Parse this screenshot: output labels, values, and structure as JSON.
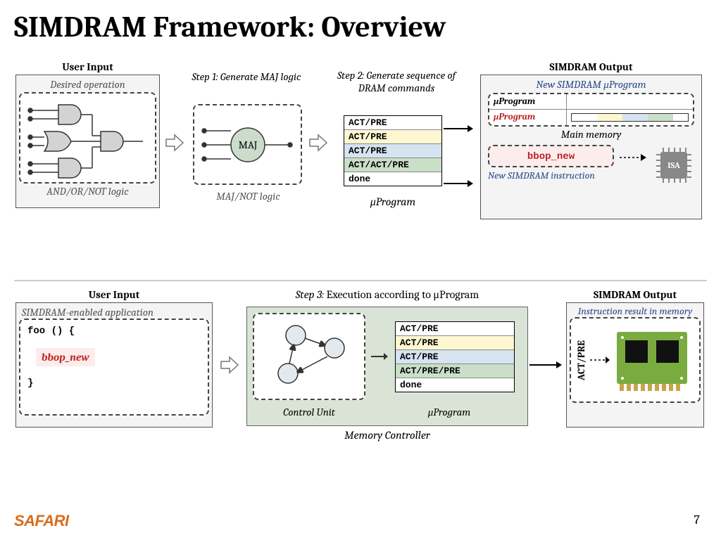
{
  "title": "SIMDRAM Framework: Overview",
  "top": {
    "userInputLabel": "User Input",
    "desiredOp": "Desired operation",
    "andOrNot": "AND/OR/NOT logic",
    "step1": "Step 1: Generate MAJ logic",
    "maj": "MAJ",
    "majNot": "MAJ/NOT logic",
    "step2": "Step 2: Generate sequence of DRAM commands",
    "cmds": [
      "ACT/PRE",
      "ACT/PRE",
      "ACT/PRE",
      "ACT/ACT/PRE",
      "done"
    ],
    "uprog": "μProgram",
    "outputLabel": "SIMDRAM Output",
    "newUprog": "New SIMDRAM μProgram",
    "uprogHead": "μProgram",
    "uprogRed": "μProgram",
    "mainMem": "Main memory",
    "bbop": "bbop_new",
    "newInst": "New SIMDRAM instruction",
    "isa": "ISA"
  },
  "bot": {
    "userInputLabel": "User Input",
    "appLabel": "SIMDRAM-enabled application",
    "foo1": "foo () {",
    "bbop": "bbop_new",
    "foo2": "}",
    "step3a": "Step 3:",
    "step3b": " Execution according to μProgram",
    "controlUnit": "Control Unit",
    "cmds": [
      "ACT/PRE",
      "ACT/PRE",
      "ACT/PRE",
      "ACT/PRE/PRE",
      "done"
    ],
    "uprog": "μProgram",
    "memCtrl": "Memory Controller",
    "outputLabel": "SIMDRAM Output",
    "result": "Instruction result in memory",
    "actpre": "ACT/PRE"
  },
  "footer": {
    "name": "SAFARI",
    "num": "7"
  }
}
